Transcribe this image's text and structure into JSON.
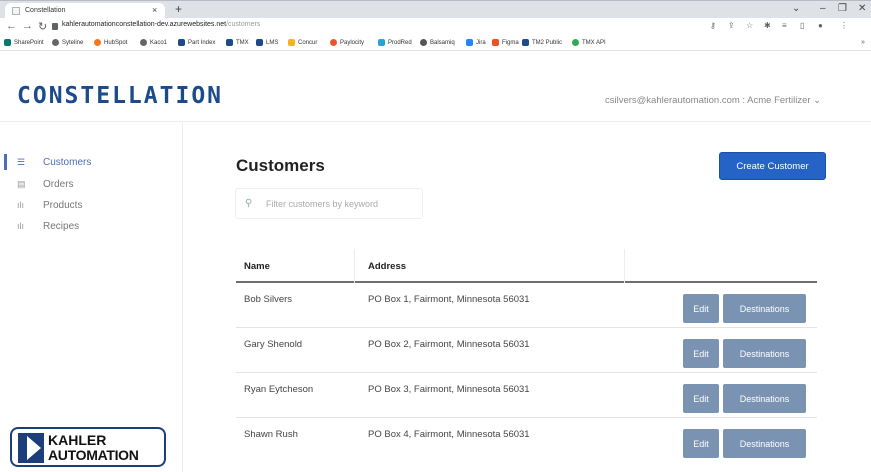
{
  "browser": {
    "tab_title": "Constellation",
    "tab_close": "×",
    "new_tab": "+",
    "url_host": "kahlerautomationconstellation-dev.azurewebsites.net",
    "url_path": "/customers",
    "bookmarks": [
      "SharePoint",
      "Syteline",
      "HubSpot",
      "Kaco1",
      "Part Index",
      "TMX",
      "LMS",
      "Concur",
      "Paylocity",
      "ProdRed",
      "Balsamiq",
      "Jira",
      "Figma",
      "TM2 Public",
      "TMX API"
    ],
    "bookmarks_more": "»"
  },
  "app": {
    "logo_text": "CONSTELLATION",
    "account": "csilvers@kahlerautomation.com : Acme Fertilizer ⌄"
  },
  "sidebar": {
    "items": [
      {
        "label": "Customers",
        "icon": "list-icon",
        "active": true
      },
      {
        "label": "Orders",
        "icon": "orders-icon",
        "active": false
      },
      {
        "label": "Products",
        "icon": "bar-chart-icon",
        "active": false
      },
      {
        "label": "Recipes",
        "icon": "bar-chart-icon",
        "active": false
      }
    ],
    "brand": {
      "line1": "KAHLER",
      "line2": "AUTOMATION"
    }
  },
  "main": {
    "title": "Customers",
    "create_button": "Create Customer",
    "search_placeholder": "Filter customers by keyword",
    "table": {
      "columns": [
        "Name",
        "Address"
      ],
      "rows": [
        {
          "name": "Bob Silvers",
          "address": "PO Box 1, Fairmont, Minnesota 56031"
        },
        {
          "name": "Gary Shenold",
          "address": "PO Box 2, Fairmont, Minnesota 56031"
        },
        {
          "name": "Ryan Eytcheson",
          "address": "PO Box 3, Fairmont, Minnesota 56031"
        },
        {
          "name": "Shawn Rush",
          "address": "PO Box 4, Fairmont, Minnesota 56031"
        }
      ],
      "edit_label": "Edit",
      "destinations_label": "Destinations"
    }
  },
  "colors": {
    "primary_button": "#2563c7",
    "row_button": "#7a93b3",
    "brand_blue": "#1c4a8a"
  }
}
